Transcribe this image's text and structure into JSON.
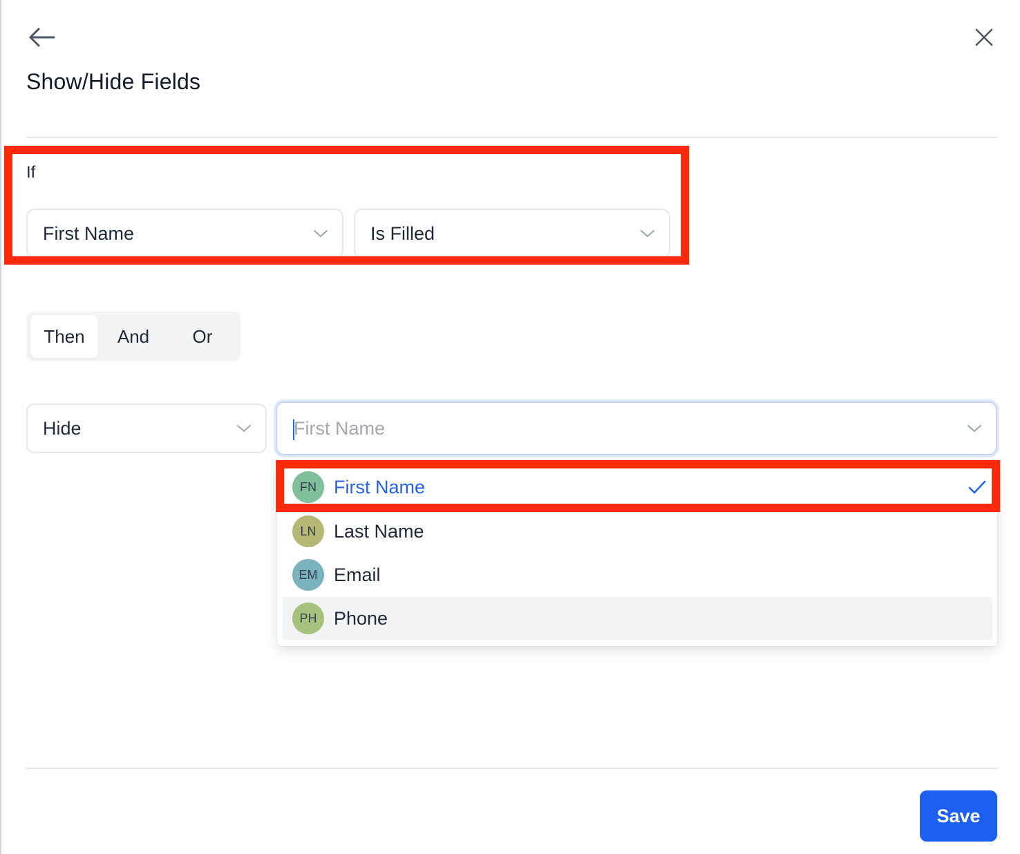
{
  "header": {
    "title": "Show/Hide Fields",
    "back_icon": "arrow-left-icon",
    "close_icon": "close-icon"
  },
  "condition": {
    "if_label": "If",
    "field_value": "First Name",
    "operator_value": "Is Filled"
  },
  "logic_tabs": [
    {
      "label": "Then",
      "active": true
    },
    {
      "label": "And",
      "active": false
    },
    {
      "label": "Or",
      "active": false
    }
  ],
  "action": {
    "value": "Hide",
    "fields_placeholder": "First Name"
  },
  "field_options": [
    {
      "initials": "FN",
      "label": "First Name",
      "avatar_color": "#7fbf9b",
      "selected": true
    },
    {
      "initials": "LN",
      "label": "Last Name",
      "avatar_color": "#b5b874",
      "selected": false
    },
    {
      "initials": "EM",
      "label": "Email",
      "avatar_color": "#7ab3bd",
      "selected": false
    },
    {
      "initials": "PH",
      "label": "Phone",
      "avatar_color": "#a4c27c",
      "selected": false
    }
  ],
  "footer": {
    "save_label": "Save"
  },
  "colors": {
    "accent": "#1d5ff0",
    "highlight": "#ff2a0a",
    "selected_text": "#2563eb"
  }
}
